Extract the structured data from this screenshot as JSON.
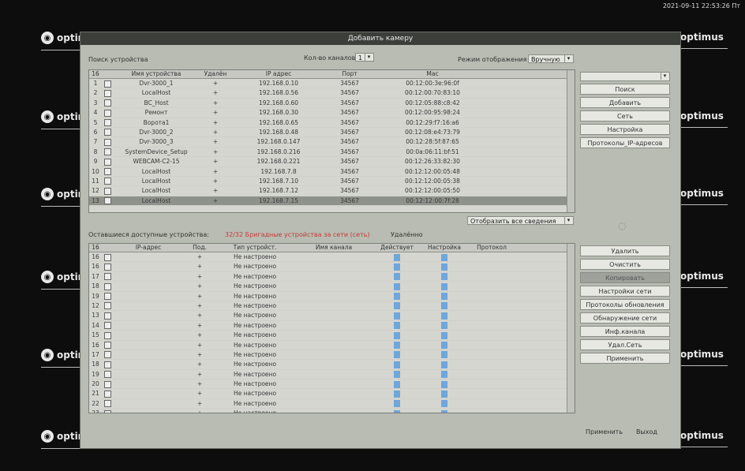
{
  "clock": "2021-09-11 22:53:26 Пт",
  "logo_text": "optimus",
  "logo_text_short": "optim",
  "window_title": "Добавить камеру",
  "top": {
    "devices_label": "Поиск устройства",
    "count_label": "Кол-во каналов",
    "count_value": "1",
    "mode_label": "Режим отображения",
    "mode_value": "Вручную"
  },
  "top_table": {
    "headers": [
      "16",
      "",
      "Имя устройства",
      "Удалён",
      "IP адрес",
      "Порт",
      "Mac"
    ],
    "rows": [
      [
        "1",
        "",
        "Dvr-3000_1",
        "+",
        "192.168.0.10",
        "34567",
        "00:12:00:3e:96:0f"
      ],
      [
        "2",
        "",
        "LocalHost",
        "+",
        "192.168.0.56",
        "34567",
        "00:12:00:70:83:10"
      ],
      [
        "3",
        "",
        "BC_Host",
        "+",
        "192.168.0.60",
        "34567",
        "00:12:05:88:c8:42"
      ],
      [
        "4",
        "",
        "Ремонт",
        "+",
        "192.168.0.30",
        "34567",
        "00:12:00:95:98:24"
      ],
      [
        "5",
        "",
        "Ворота1",
        "+",
        "192.168.0.65",
        "34567",
        "00:12:29:f7:16:a6"
      ],
      [
        "6",
        "",
        "Dvr-3000_2",
        "+",
        "192.168.0.48",
        "34567",
        "00:12:08:e4:73:79"
      ],
      [
        "7",
        "",
        "Dvr-3000_3",
        "+",
        "192.168.0.147",
        "34567",
        "00:12:28:5f:87:65"
      ],
      [
        "8",
        "",
        "SystemDevice_Setup",
        "+",
        "192.168.0.216",
        "34567",
        "00:0a:06:11:bf:51"
      ],
      [
        "9",
        "",
        "WEBCAM-C2-15",
        "+",
        "192.168.0.221",
        "34567",
        "00:12:26:33:82:30"
      ],
      [
        "10",
        "",
        "LocalHost",
        "+",
        "192.168.7.8",
        "34567",
        "00:12:12:00:05:48"
      ],
      [
        "11",
        "",
        "LocalHost",
        "+",
        "192.168.7.10",
        "34567",
        "00:12:12:00:05:38"
      ],
      [
        "12",
        "",
        "LocalHost",
        "+",
        "192.168.7.12",
        "34567",
        "00:12:12:00:05:50"
      ],
      [
        "13",
        "",
        "LocalHost",
        "+",
        "192.168.7.15",
        "34567",
        "00:12:12:00:7f:28"
      ]
    ]
  },
  "filter_label": "Отобразить все сведения",
  "side_top_select": "",
  "side_buttons_top": [
    "Поиск",
    "Добавить",
    "Сеть",
    "Настройка",
    "Протоколы_IP-адресов"
  ],
  "status_line": {
    "left": "Оставшиеся доступные устройства:",
    "red": "32/32 Бригадные устройства за сети (сеть)",
    "right": "Удалённо"
  },
  "bottom_table": {
    "headers": [
      "16",
      "",
      "IP-адрес",
      "Под.",
      "Тип устройст.",
      "Имя канала",
      "Действует",
      "Настройка",
      "Протокол"
    ],
    "rows": [
      [
        "16",
        "",
        "",
        "+",
        "Не настроено",
        "",
        "",
        "",
        ""
      ],
      [
        "16",
        "",
        "",
        "+",
        "Не настроено",
        "",
        "",
        "",
        ""
      ],
      [
        "17",
        "",
        "",
        "+",
        "Не настроено",
        "",
        "",
        "",
        ""
      ],
      [
        "18",
        "",
        "",
        "+",
        "Не настроено",
        "",
        "",
        "",
        ""
      ],
      [
        "19",
        "",
        "",
        "+",
        "Не настроено",
        "",
        "",
        "",
        ""
      ],
      [
        "12",
        "",
        "",
        "+",
        "Не настроено",
        "",
        "",
        "",
        ""
      ],
      [
        "13",
        "",
        "",
        "+",
        "Не настроено",
        "",
        "",
        "",
        ""
      ],
      [
        "14",
        "",
        "",
        "+",
        "Не настроено",
        "",
        "",
        "",
        ""
      ],
      [
        "15",
        "",
        "",
        "+",
        "Не настроено",
        "",
        "",
        "",
        ""
      ],
      [
        "16",
        "",
        "",
        "+",
        "Не настроено",
        "",
        "",
        "",
        ""
      ],
      [
        "17",
        "",
        "",
        "+",
        "Не настроено",
        "",
        "",
        "",
        ""
      ],
      [
        "18",
        "",
        "",
        "+",
        "Не настроено",
        "",
        "",
        "",
        ""
      ],
      [
        "19",
        "",
        "",
        "+",
        "Не настроено",
        "",
        "",
        "",
        ""
      ],
      [
        "20",
        "",
        "",
        "+",
        "Не настроено",
        "",
        "",
        "",
        ""
      ],
      [
        "21",
        "",
        "",
        "+",
        "Не настроено",
        "",
        "",
        "",
        ""
      ],
      [
        "22",
        "",
        "",
        "+",
        "Не настроено",
        "",
        "",
        "",
        ""
      ],
      [
        "23",
        "",
        "",
        "+",
        "Не настроено",
        "",
        "",
        "",
        ""
      ]
    ]
  },
  "side_buttons_bottom": [
    "Удалить",
    "Очистить",
    "Копировать",
    "Настройки сети",
    "Протоколы обновления",
    "Обнаружение сети",
    "Инф.канала",
    "Удал.Сеть",
    "Применить"
  ],
  "footer": {
    "apply": "Применить",
    "exit": "Выход"
  }
}
